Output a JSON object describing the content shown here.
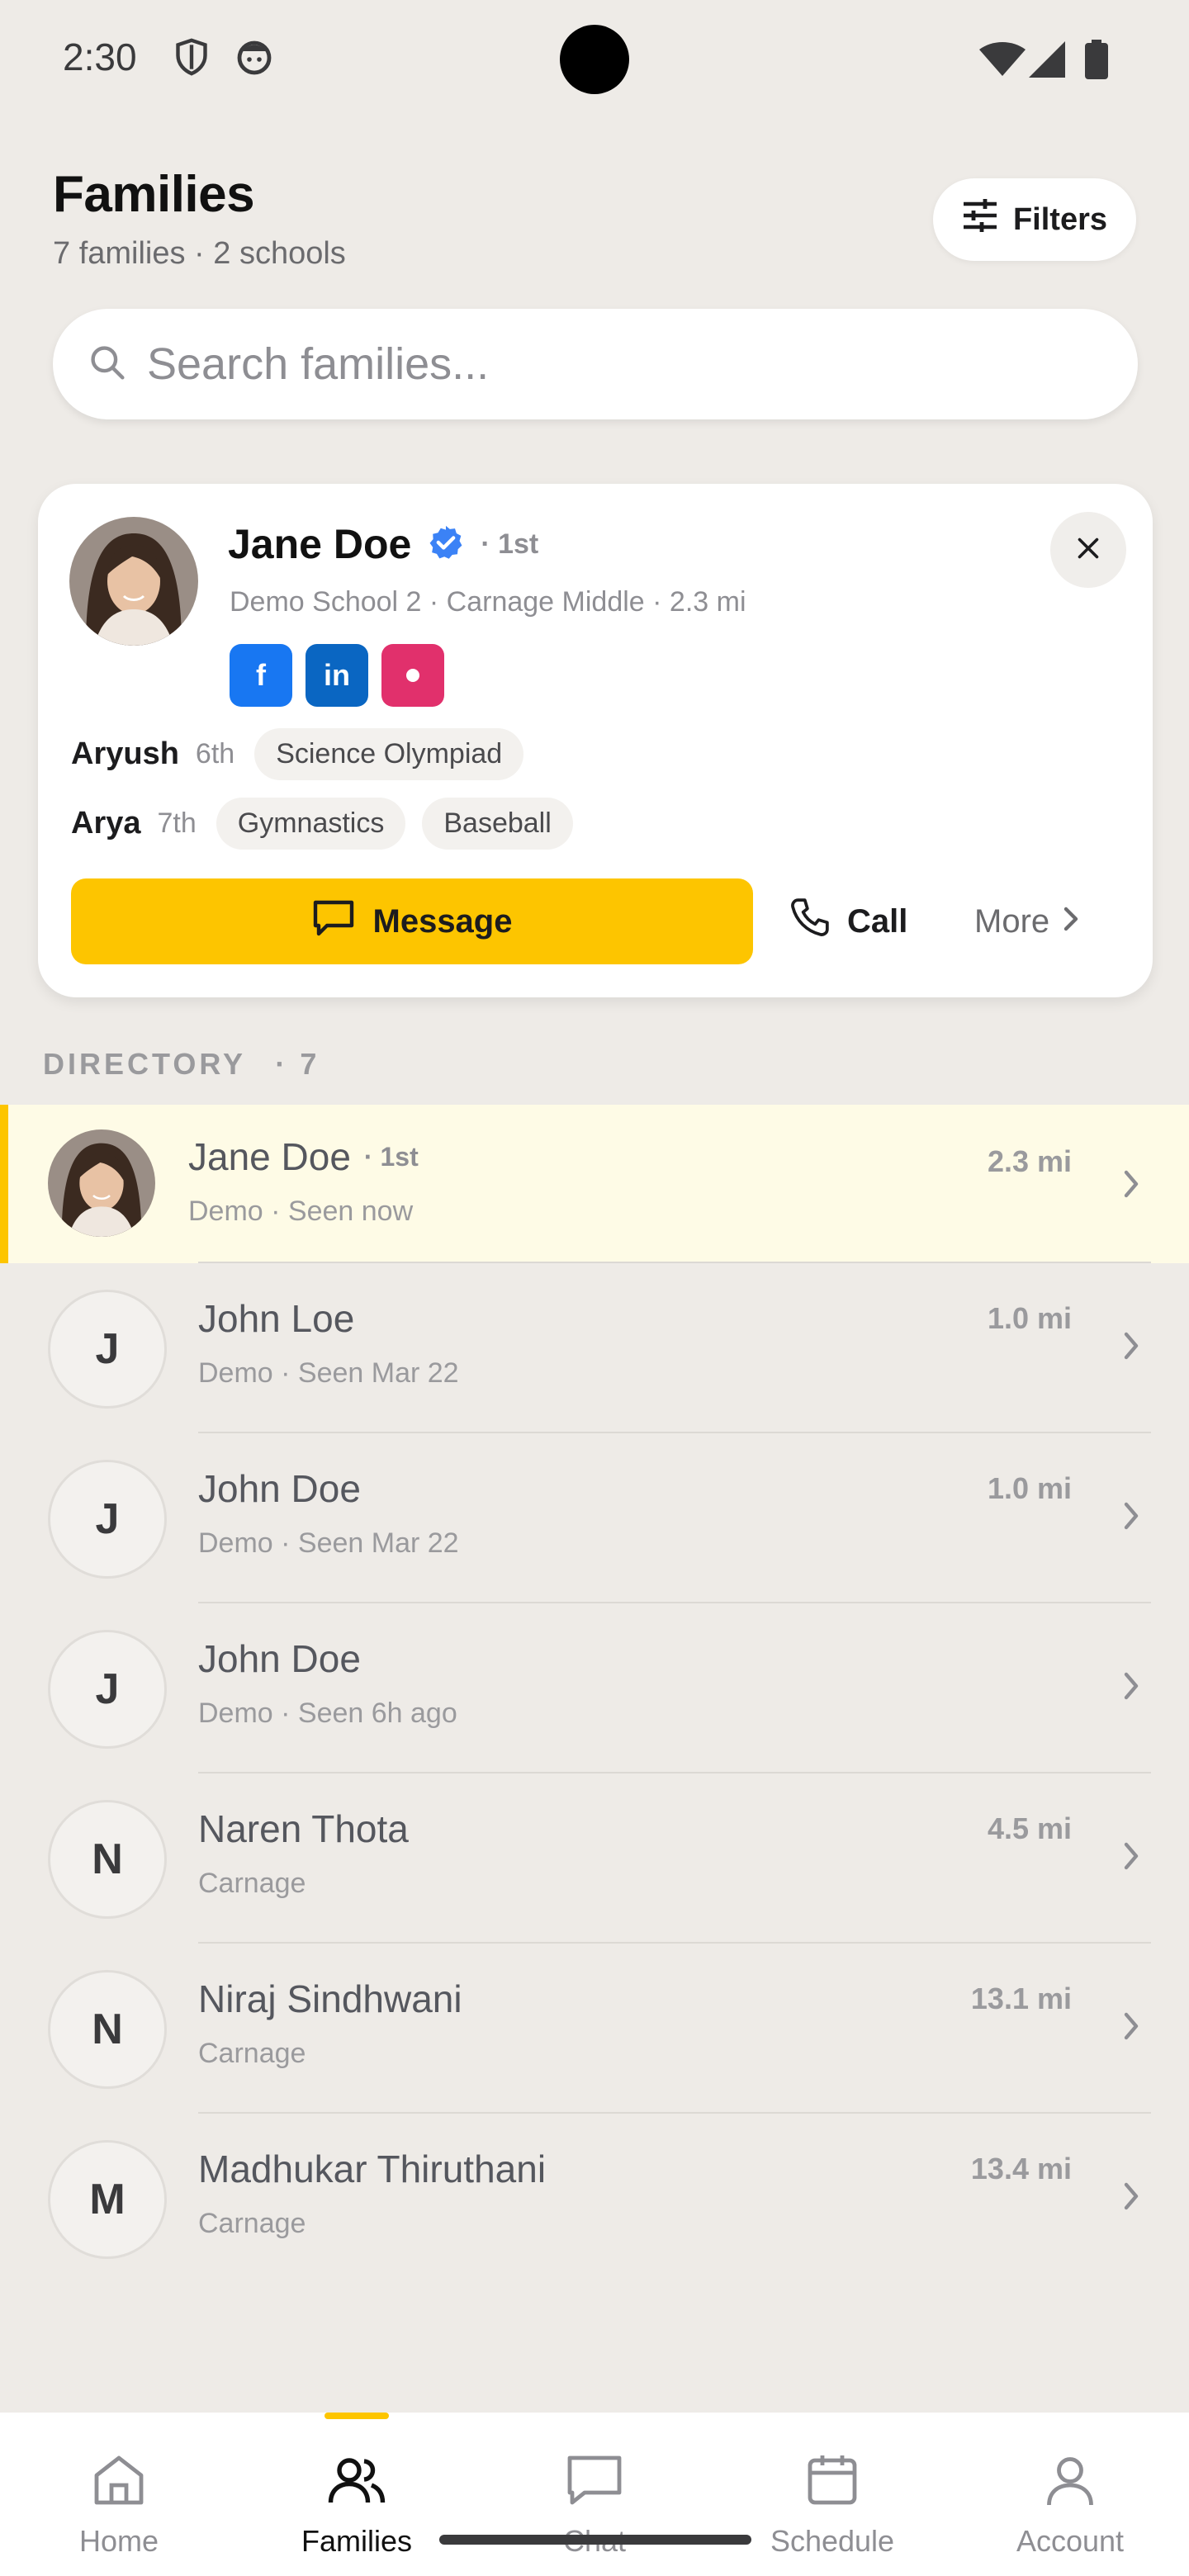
{
  "status_bar": {
    "time": "2:30"
  },
  "header": {
    "title": "Families",
    "subtitle": "7 families · 2 schools",
    "filters_label": "Filters"
  },
  "search": {
    "placeholder": "Search families..."
  },
  "featured": {
    "name": "Jane Doe",
    "degree": "· 1st",
    "meta": "Demo School 2 · Carnage Middle · 2.3 mi",
    "social": {
      "facebook": "f",
      "linkedin": "in"
    },
    "children": [
      {
        "name": "Aryush",
        "grade": "6th",
        "tags": [
          "Science Olympiad"
        ]
      },
      {
        "name": "Arya",
        "grade": "7th",
        "tags": [
          "Gymnastics",
          "Baseball"
        ]
      }
    ],
    "actions": {
      "message": "Message",
      "call": "Call",
      "more": "More"
    }
  },
  "directory": {
    "label": "DIRECTORY",
    "count": "· 7",
    "rows": [
      {
        "initial": "",
        "name": "Jane Doe",
        "degree": "· 1st",
        "sub": "Demo · Seen now",
        "dist": "2.3 mi"
      },
      {
        "initial": "J",
        "name": "John Loe",
        "degree": "",
        "sub": "Demo · Seen Mar 22",
        "dist": "1.0 mi"
      },
      {
        "initial": "J",
        "name": "John Doe",
        "degree": "",
        "sub": "Demo · Seen Mar 22",
        "dist": "1.0 mi"
      },
      {
        "initial": "J",
        "name": "John Doe",
        "degree": "",
        "sub": "Demo · Seen 6h ago",
        "dist": ""
      },
      {
        "initial": "N",
        "name": "Naren Thota",
        "degree": "",
        "sub": "Carnage",
        "dist": "4.5 mi"
      },
      {
        "initial": "N",
        "name": "Niraj Sindhwani",
        "degree": "",
        "sub": "Carnage",
        "dist": "13.1 mi"
      },
      {
        "initial": "M",
        "name": "Madhukar Thiruthani",
        "degree": "",
        "sub": "Carnage",
        "dist": "13.4 mi"
      }
    ]
  },
  "nav": {
    "items": [
      {
        "label": "Home",
        "icon": "home-icon"
      },
      {
        "label": "Families",
        "icon": "users-icon"
      },
      {
        "label": "Chat",
        "icon": "chat-icon"
      },
      {
        "label": "Schedule",
        "icon": "calendar-icon"
      },
      {
        "label": "Account",
        "icon": "user-icon"
      }
    ],
    "active": "Families"
  },
  "colors": {
    "accent": "#fdc500",
    "background": "#eeebe7",
    "verified": "#3b82f6",
    "active_row": "#fefbe6"
  }
}
